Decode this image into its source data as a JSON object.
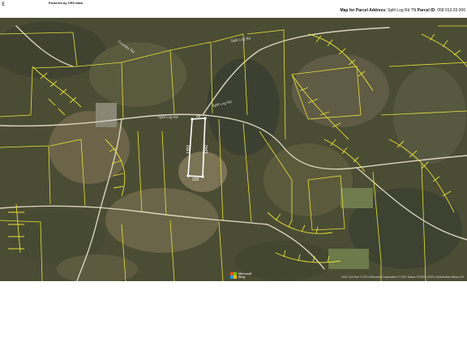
{
  "header": {
    "logo_glyph": "ε",
    "powered_by": "Powered by CRS Data",
    "map_for_label": "Map for Parcel Address:",
    "address": "Split Log Rd TN",
    "parcel_id_label": "Parcel ID:",
    "parcel_id": "058 013.03 000"
  },
  "map": {
    "imagery_provider": "Microsoft",
    "imagery_product": "Bing",
    "copyright": "2021 TomTom  © 2021 Microsoft Corporation  © 2021 Maxar ©CNES (2021) Distribution Airbus DS",
    "road_labels": [
      "Split Log Rd",
      "Split Log Rd",
      "Split Log Rd",
      "Crowder Rd"
    ],
    "parcel_dimensions": [
      "22",
      "1352",
      "1342",
      "229"
    ],
    "colors": {
      "parcel_lines": "#e6e23a",
      "subject_parcel": "#ffffff",
      "imagery_base": "#4a4b33"
    }
  }
}
